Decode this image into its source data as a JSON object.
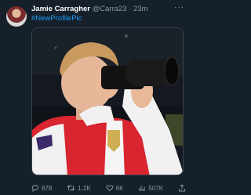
{
  "tweet": {
    "author_name": "Jamie Carragher",
    "handle": "@Carra23",
    "separator": "·",
    "time": "23m",
    "text": "#NewProfilePic"
  },
  "actions": {
    "replies": "878",
    "retweets": "1.2K",
    "likes": "6K",
    "views": "507K"
  },
  "icons": [
    "more-icon",
    "reply-icon",
    "retweet-icon",
    "like-icon",
    "views-icon",
    "share-icon"
  ],
  "colors": {
    "background": "#15202b",
    "link": "#1d9bf0",
    "muted": "#8899a6"
  }
}
